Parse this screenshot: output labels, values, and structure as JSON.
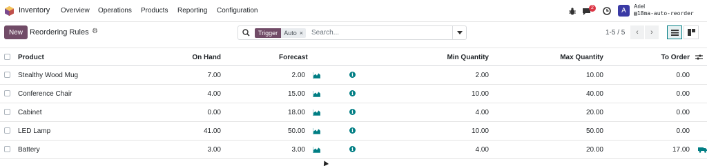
{
  "nav": {
    "app_name": "Inventory",
    "menu": [
      "Overview",
      "Operations",
      "Products",
      "Reporting",
      "Configuration"
    ],
    "messages_badge": "2",
    "avatar_letter": "A",
    "user_name": "Ariel",
    "db_name": "18ma-auto-reorder",
    "icons": [
      "bug-icon",
      "chat-icon",
      "clock-icon"
    ]
  },
  "control": {
    "new_label": "New",
    "title": "Reordering Rules",
    "search": {
      "facet_label": "Trigger",
      "facet_value": "Auto",
      "placeholder": "Search..."
    },
    "pager": "1-5 / 5"
  },
  "table": {
    "headers": {
      "product": "Product",
      "on_hand": "On Hand",
      "forecast": "Forecast",
      "min_qty": "Min Quantity",
      "max_qty": "Max Quantity",
      "to_order": "To Order"
    },
    "rows": [
      {
        "product": "Stealthy Wood Mug",
        "on_hand": "7.00",
        "forecast": "2.00",
        "min_qty": "2.00",
        "max_qty": "10.00",
        "to_order": "0.00"
      },
      {
        "product": "Conference Chair",
        "on_hand": "4.00",
        "forecast": "15.00",
        "min_qty": "10.00",
        "max_qty": "40.00",
        "to_order": "0.00"
      },
      {
        "product": "Cabinet",
        "on_hand": "0.00",
        "forecast": "18.00",
        "min_qty": "4.00",
        "max_qty": "20.00",
        "to_order": "0.00"
      },
      {
        "product": "LED Lamp",
        "on_hand": "41.00",
        "forecast": "50.00",
        "min_qty": "10.00",
        "max_qty": "50.00",
        "to_order": "0.00"
      },
      {
        "product": "Battery",
        "on_hand": "3.00",
        "forecast": "3.00",
        "min_qty": "4.00",
        "max_qty": "20.00",
        "to_order": "17.00"
      }
    ]
  },
  "colors": {
    "brand": "#714b67",
    "accent": "#017e84",
    "badge": "#dc3545"
  }
}
